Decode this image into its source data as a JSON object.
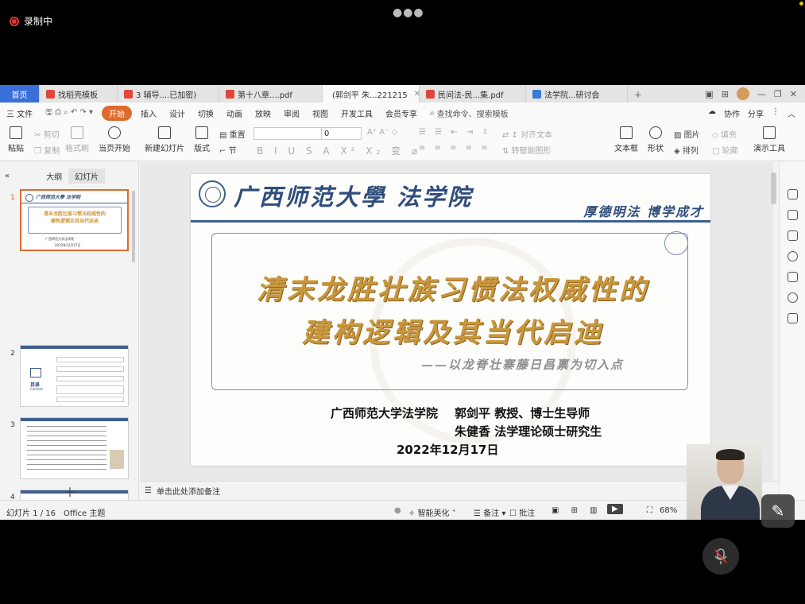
{
  "recording": {
    "label": "录制中"
  },
  "tabs": [
    {
      "label": "首页",
      "kind": "home"
    },
    {
      "label": "找稻壳模板",
      "kind": "red"
    },
    {
      "label": "3 辅导....已加密)",
      "kind": "red"
    },
    {
      "label": "第十八章....pdf",
      "kind": "red"
    },
    {
      "label": "(郭剑平 朱...221215",
      "kind": "orange",
      "active": true
    },
    {
      "label": "民间法-民...集.pdf",
      "kind": "red"
    },
    {
      "label": "法学院...研讨会",
      "kind": "blue"
    }
  ],
  "menubar": {
    "file": "三 文件",
    "items": [
      "开始",
      "插入",
      "设计",
      "切换",
      "动画",
      "放映",
      "审阅",
      "视图",
      "开发工具",
      "会员专享"
    ],
    "search": "查找命令、搜索模板",
    "right": [
      "协作",
      "分享"
    ]
  },
  "ribbon": {
    "paste": "粘贴",
    "cut": "剪切",
    "copy": "复制",
    "format_brush": "格式刷",
    "from_current": "当页开始",
    "new_slide": "新建幻灯片",
    "layout": "版式",
    "reset": "重置",
    "section": "节",
    "font_size": "0",
    "text_dir": "文字方向",
    "align_text": "对齐文本",
    "convert_smart": "转智能图形",
    "textbox": "文本框",
    "shape": "形状",
    "picture": "图片",
    "arrange": "排列",
    "fill": "填充",
    "outline": "轮廓",
    "present_tools": "演示工具"
  },
  "left_panel": {
    "tabs": [
      "大纲",
      "幻灯片"
    ],
    "slide_numbers": [
      "1",
      "2",
      "3",
      "4"
    ]
  },
  "slide": {
    "school": "广西师范大學 法学院",
    "motto": "厚德明法  博学成才",
    "title_line1": "清末龙胜壮族习惯法权威性的",
    "title_line2": "建构逻辑及其当代启迪",
    "subtitle": "——以龙脊壮寨藤日昌禀为切入点",
    "institution": "广西师范大学法学院",
    "author1": "郭剑平  教授、博士生导师",
    "author2": "朱健香  法学理论硕士研究生",
    "date": "2022年12月17日"
  },
  "thumb2": {
    "title": "目录",
    "subtitle": "Content"
  },
  "notes_placeholder": "单击此处添加备注",
  "status": {
    "slide_count": "幻灯片 1 / 16",
    "theme": "Office 主题",
    "smart_beautify": "智能美化",
    "notes": "备注",
    "comments": "批注",
    "zoom": "68%"
  }
}
